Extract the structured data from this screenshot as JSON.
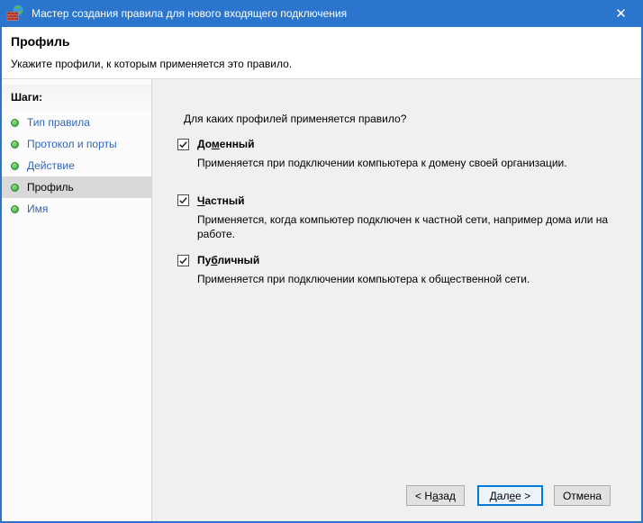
{
  "colors": {
    "frame": "#2b76cc",
    "link": "#3465b4",
    "bullet": "#2c9b2c",
    "stepsel": "#d9d9d9",
    "nextbd": "#0078d7",
    "nextbg": "#ebf3fb"
  },
  "icons": {
    "app": "firewall-icon",
    "close": "✕"
  },
  "window": {
    "title": "Мастер создания правила для нового входящего подключения"
  },
  "header": {
    "title": "Профиль",
    "subtitle": "Укажите профили, к которым применяется это правило."
  },
  "sidebar": {
    "heading": "Шаги:",
    "items": [
      {
        "label": "Тип правила",
        "selected": false
      },
      {
        "label": "Протокол и порты",
        "selected": false
      },
      {
        "label": "Действие",
        "selected": false
      },
      {
        "label": "Профиль",
        "selected": true
      },
      {
        "label": "Имя",
        "selected": false
      }
    ]
  },
  "main": {
    "question": "Для каких профилей применяется правило?",
    "profiles": [
      {
        "label": {
          "text": "Доменный",
          "u": 2
        },
        "checked": true,
        "description": "Применяется при подключении компьютера к домену своей организации."
      },
      {
        "label": {
          "text": "Частный",
          "u": 0
        },
        "checked": true,
        "description": "Применяется, когда компьютер подключен к частной сети, например дома или на работе."
      },
      {
        "label": {
          "text": "Публичный",
          "u": 2
        },
        "checked": true,
        "description": "Применяется при подключении компьютера к общественной сети."
      }
    ]
  },
  "buttons": {
    "back": {
      "text": "< Назад",
      "u": 3
    },
    "next": {
      "text": "Далее >",
      "u": 3
    },
    "cancel": {
      "text": "Отмена",
      "u": -1
    }
  }
}
